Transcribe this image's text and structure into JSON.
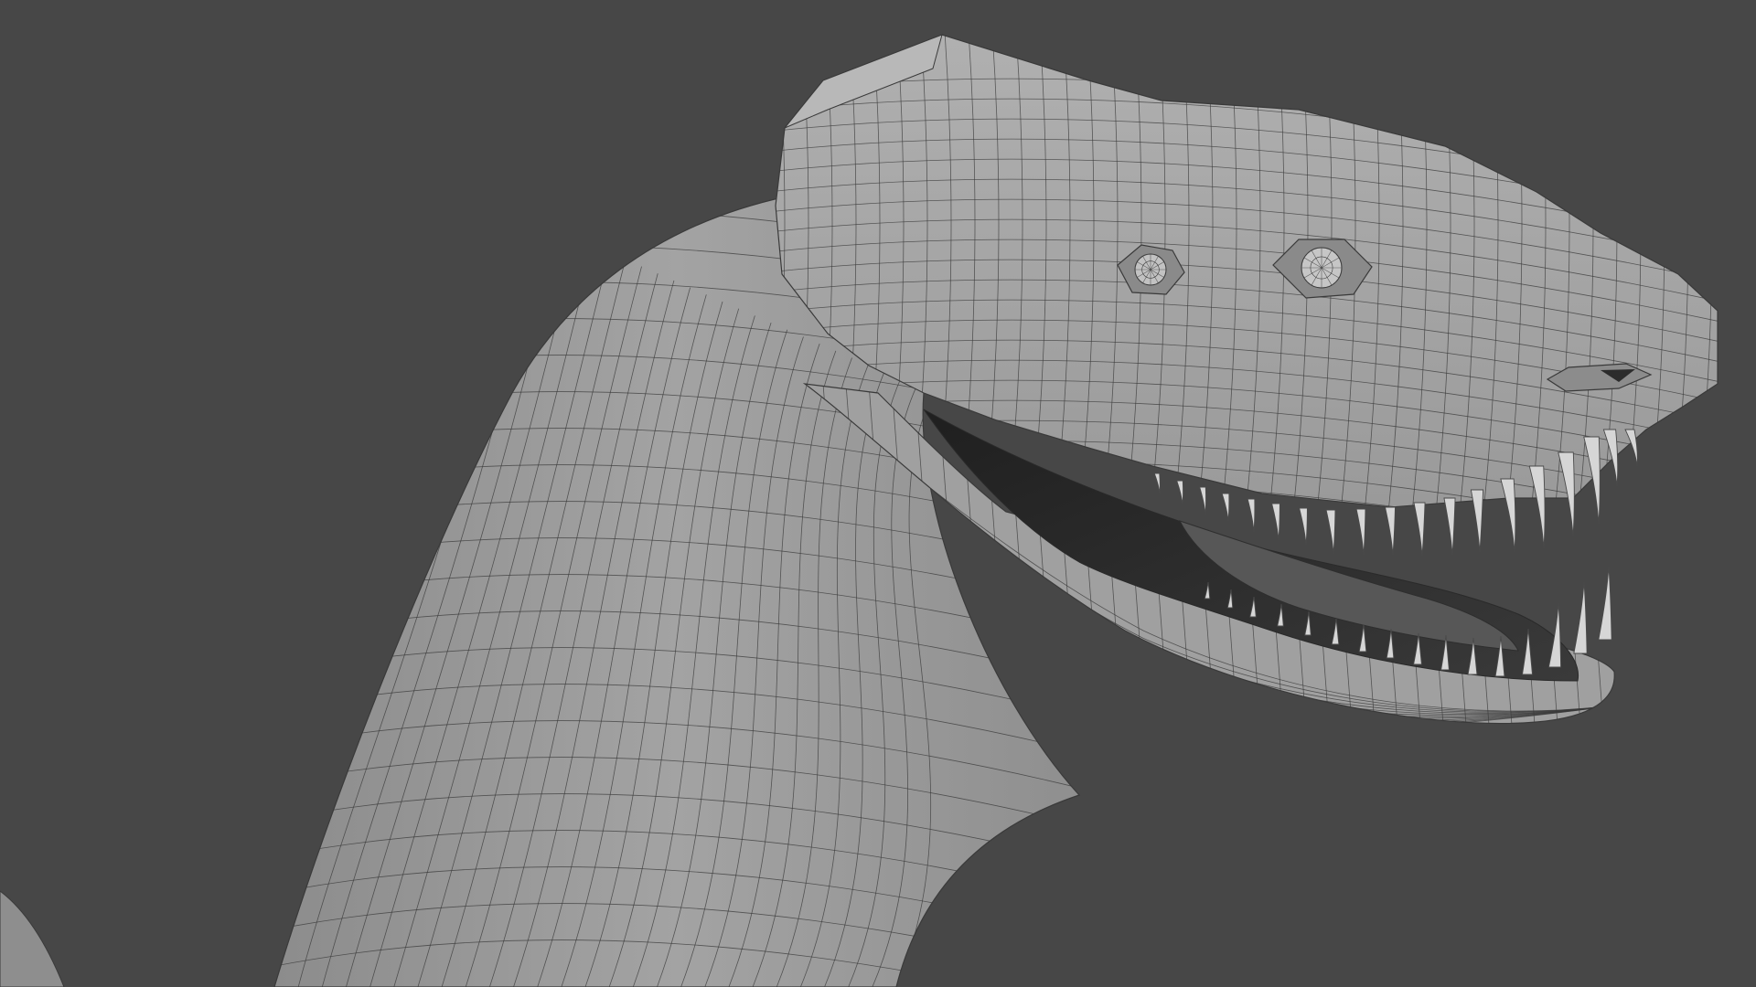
{
  "viewport": {
    "background_color": "#474747",
    "subject": "creature-head-wireframe",
    "shading": "solid-gray-with-wireframe"
  },
  "colors": {
    "mesh_base": "#9a9a9a",
    "mesh_light": "#b2b2b2",
    "mesh_dark": "#7c7c7c",
    "wire": "#3a3a3a",
    "mouth_dark": "#262626",
    "tooth": "#d6d6d6"
  }
}
